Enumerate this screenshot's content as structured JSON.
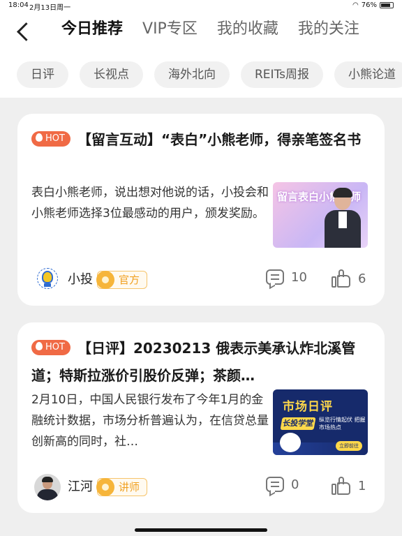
{
  "status": {
    "time": "18:04",
    "date": "2月13日周一",
    "battery": "76%"
  },
  "nav": {
    "tabs": [
      {
        "label": "今日推荐",
        "active": true
      },
      {
        "label": "VIP专区",
        "active": false
      },
      {
        "label": "我的收藏",
        "active": false
      },
      {
        "label": "我的关注",
        "active": false
      }
    ]
  },
  "chips": [
    "日评",
    "长视点",
    "海外北向",
    "REITs周报",
    "小熊论道"
  ],
  "cards": [
    {
      "hot_label": "HOT",
      "title": "【留言互动】“表白”小熊老师，得亲笔签名书",
      "summary": "表白小熊老师，说出想对他说的话，小投会和小熊老师选择3位最感动的用户，颁发奖励。",
      "thumb_text": "留言表白小熊老师",
      "author": "小投",
      "badge": "官方",
      "comments": "10",
      "likes": "6"
    },
    {
      "hot_label": "HOT",
      "title": "【日评】20230213 俄表示美承认炸北溪管道；特斯拉涨价引股价反弹；茶颜…",
      "summary": "2月10日，中国人民银行发布了今年1月的金融统计数据，市场分析普遍认为，在信贷总量创新高的同时，社…",
      "thumb_title": "市场日评",
      "thumb_tag": "长投学堂",
      "thumb_sub": "纵览行情起伏 把握市场热点",
      "thumb_btn": "立即前往",
      "author": "江河",
      "badge": "讲师",
      "comments": "0",
      "likes": "1"
    }
  ]
}
